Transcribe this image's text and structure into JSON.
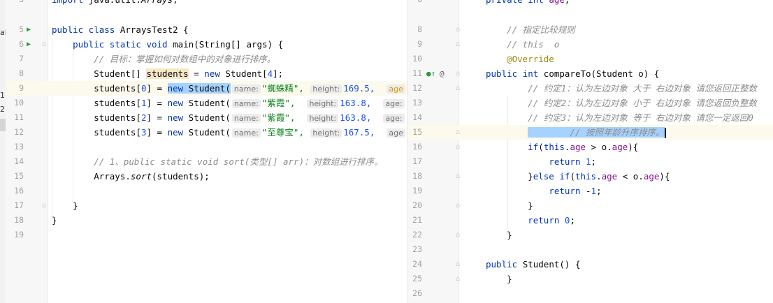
{
  "overview": [
    "al",
    "1",
    "2"
  ],
  "left": {
    "lines": [
      {
        "n": "3",
        "t": "import java.util.Arrays;"
      },
      {
        "n": "5",
        "t": "public class ArraysTest2 {"
      },
      {
        "n": "6",
        "t": "    public static void main(String[] args) {"
      },
      {
        "n": "7",
        "t": "        // 目标：掌握如何对数组中的对象进行排序。"
      },
      {
        "n": "8",
        "t": "        Student[] students = new Student[4];"
      },
      {
        "n": "9",
        "t": "        students[0] = new Student(",
        "hints": [
          "name:",
          "\"蜘蛛精\",",
          "height:",
          "169.5,",
          "age"
        ]
      },
      {
        "n": "10",
        "t": "        students[1] = new Student(",
        "hints": [
          "name:",
          "\"紫霞\",",
          "height:",
          "163.8,",
          "age:"
        ]
      },
      {
        "n": "11",
        "t": "        students[2] = new Student(",
        "hints": [
          "name:",
          "\"紫霞\",",
          "height:",
          "163.8,",
          "age:"
        ]
      },
      {
        "n": "12",
        "t": "        students[3] = new Student(",
        "hints": [
          "name:",
          "\"至尊宝\",",
          "height:",
          "167.5,",
          "age"
        ]
      },
      {
        "n": "13",
        "t": ""
      },
      {
        "n": "14",
        "t": "        // 1、public static void sort(类型[] arr)：对数组进行排序。"
      },
      {
        "n": "15",
        "t": "        Arrays.sort(students);"
      },
      {
        "n": "16",
        "t": ""
      },
      {
        "n": "17",
        "t": "    }"
      },
      {
        "n": "18",
        "t": "}"
      },
      {
        "n": "19",
        "t": ""
      }
    ]
  },
  "right": {
    "lines": [
      {
        "n": "6",
        "t": "    private int age;"
      },
      {
        "n": "8",
        "t": "    // 指定比较规则"
      },
      {
        "n": "9",
        "t": "    // this  o"
      },
      {
        "n": "10",
        "t": "    @Override"
      },
      {
        "n": "11",
        "t": "    public int compareTo(Student o) {"
      },
      {
        "n": "12",
        "t": "        // 约定1：认为左边对象 大于 右边对象 请您返回正整数"
      },
      {
        "n": "13",
        "t": "        // 约定2：认为左边对象 小于 右边对象 请您返回负整数"
      },
      {
        "n": "14",
        "t": "        // 约定3：认为左边对象 等于 右边对象 请您一定返回0"
      },
      {
        "n": "15",
        "t": "        // 按照年龄升序排序。"
      },
      {
        "n": "16",
        "t": "        if(this.age > o.age){"
      },
      {
        "n": "17",
        "t": "            return 1;"
      },
      {
        "n": "18",
        "t": "        }else if(this.age < o.age){"
      },
      {
        "n": "19",
        "t": "            return -1;"
      },
      {
        "n": "20",
        "t": "        }"
      },
      {
        "n": "21",
        "t": "        return 0;"
      },
      {
        "n": "22",
        "t": "    }"
      },
      {
        "n": "23",
        "t": ""
      },
      {
        "n": "24",
        "t": "    public Student() {"
      },
      {
        "n": "25",
        "t": "    }"
      },
      {
        "n": "26",
        "t": ""
      }
    ]
  }
}
